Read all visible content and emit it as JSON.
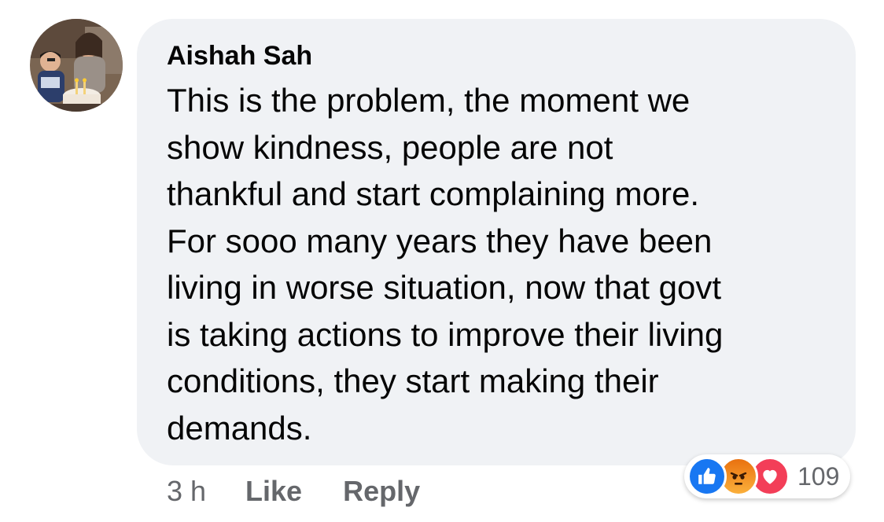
{
  "comment": {
    "author": "Aishah Sah",
    "text": "This is the problem, the moment we\nshow kindness, people are not\nthankful and start complaining more.\nFor sooo many years they have been\nliving in worse situation,  now that govt\nis taking actions to improve their living\nconditions, they start making their\ndemands.",
    "timestamp": "3 h",
    "like_label": "Like",
    "reply_label": "Reply",
    "reactions": {
      "icons": [
        "like-icon",
        "angry-icon",
        "love-icon"
      ],
      "count": "109"
    }
  },
  "colors": {
    "bubble": "#f0f2f5",
    "text": "#050505",
    "meta": "#65676b",
    "like": "#1877f2",
    "love": "#f33e58",
    "angry": "#e9710f"
  }
}
